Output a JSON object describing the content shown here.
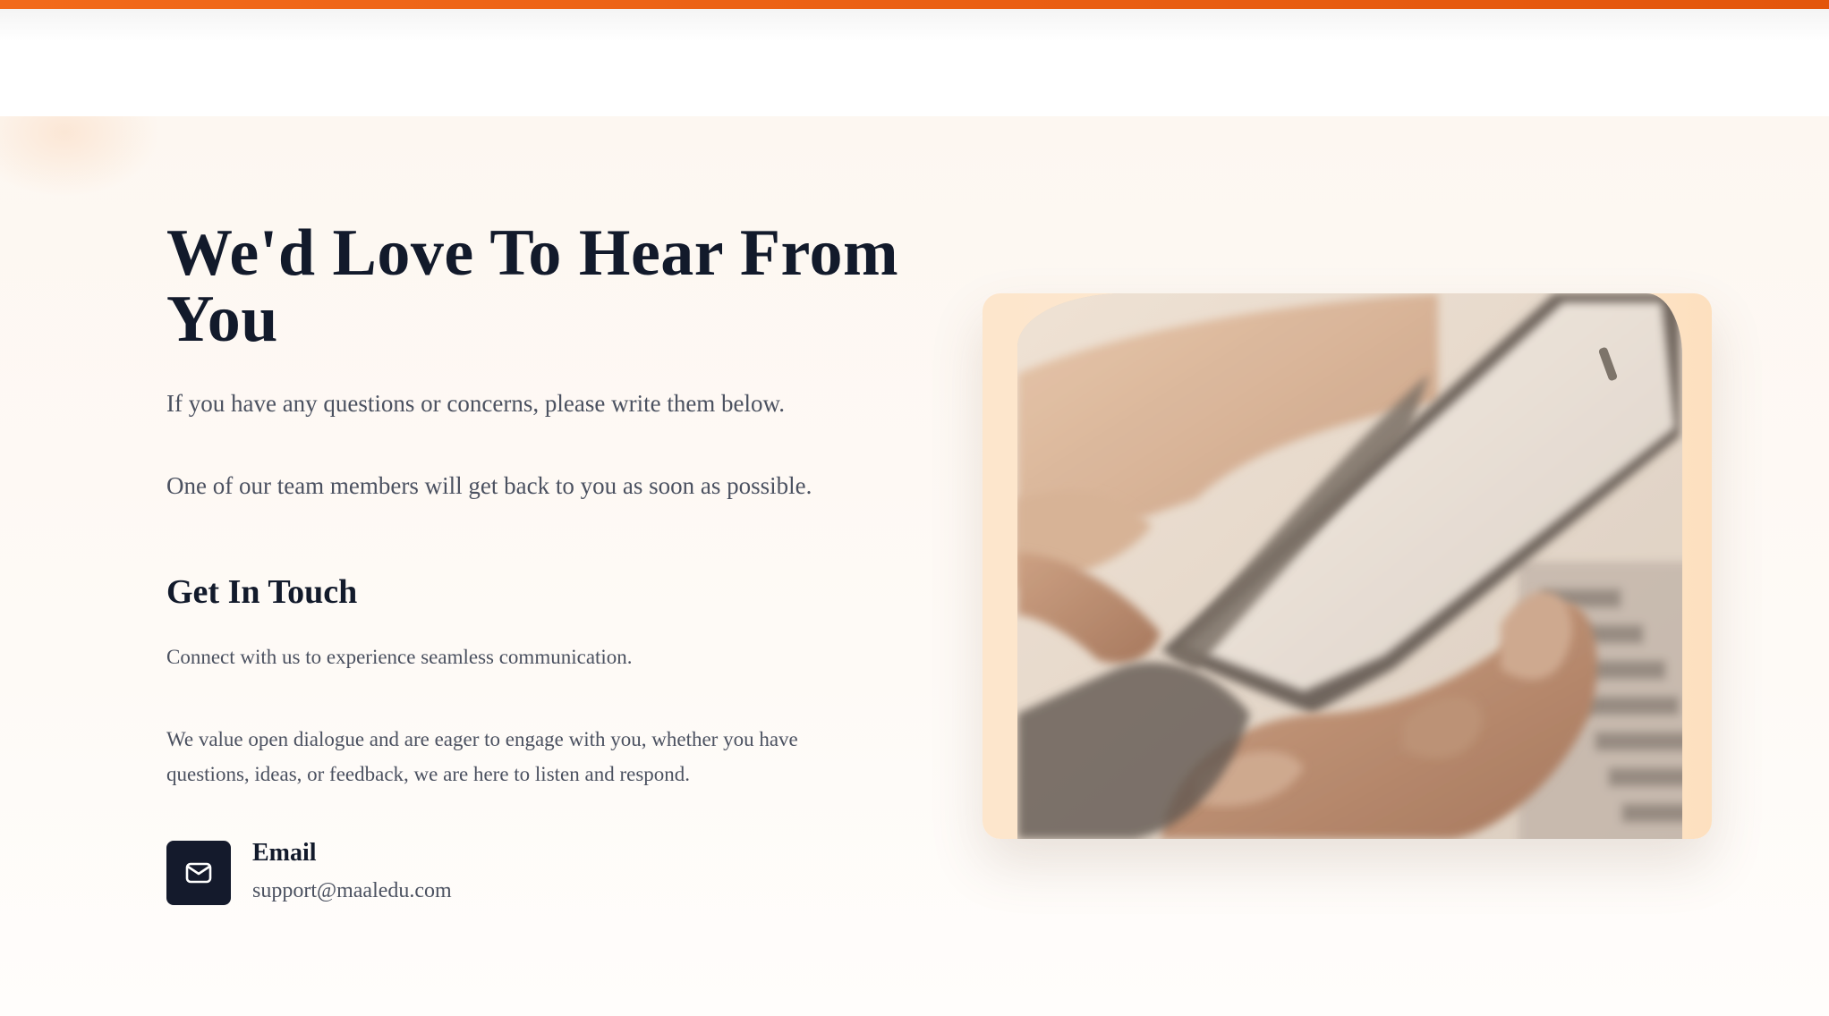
{
  "colors": {
    "accent": "#ea5f12",
    "heading": "#121a2b",
    "body_text": "#4b5160",
    "icon_tile": "#141a2c",
    "hero_background": "#fdf7f1",
    "card_background": "#fde6cc"
  },
  "hero": {
    "title": "We'd Love To Hear From You",
    "intro": "If you have any questions or concerns, please write them below.",
    "intro_2": "One of our team members will get back to you as soon as possible."
  },
  "get_in_touch": {
    "heading": "Get In Touch",
    "description": "Connect with us to experience seamless communication.",
    "description_2": "We value open dialogue and are eager to engage with you, whether you have questions, ideas, or feedback, we are here to listen and respond."
  },
  "contact": {
    "email": {
      "icon": "mail-icon",
      "label": "Email",
      "value": "support@maaledu.com"
    }
  },
  "image": {
    "subject": "hand-holding-smartphone-photo"
  }
}
